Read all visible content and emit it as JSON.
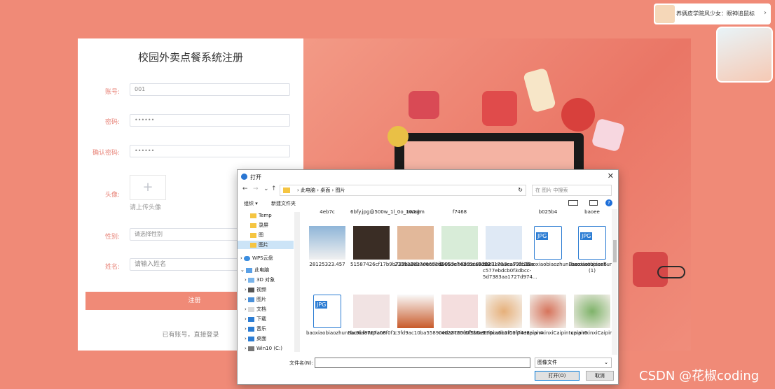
{
  "register": {
    "title": "校园外卖点餐系统注册",
    "account_label": "账号:",
    "account_value": "001",
    "password_label": "密码:",
    "password_value": "••••••",
    "confirm_label": "确认密码:",
    "confirm_value": "••••••",
    "avatar_label": "头像:",
    "avatar_plus": "+",
    "avatar_hint": "请上传头像",
    "gender_label": "性别:",
    "gender_placeholder": "请选择性别",
    "name_label": "姓名:",
    "name_placeholder": "请输入姓名",
    "submit_label": "注册",
    "login_link": "已有账号，直接登录"
  },
  "ad": {
    "text": "养俩皮学院风少女：眼神追鼠标",
    "arrow": "›"
  },
  "dialog": {
    "title": "打开",
    "close": "✕",
    "nav_back": "←",
    "nav_forward": "→",
    "nav_recent": "⌄",
    "nav_up": "↑",
    "breadcrumb": "›  此电脑  ›  桌面  ›  图片",
    "refresh": "↻",
    "search_placeholder": "在 图片 中搜索",
    "toolbar_organize": "组织 ▾",
    "toolbar_new_folder": "新建文件夹",
    "help": "?",
    "tree": [
      {
        "label": "Temp",
        "kind": "folder"
      },
      {
        "label": "录屏",
        "kind": "folder"
      },
      {
        "label": "图",
        "kind": "folder"
      },
      {
        "label": "图片",
        "kind": "folder",
        "selected": true
      },
      {
        "label": "WPS云盘",
        "kind": "cloud"
      },
      {
        "label": "此电脑",
        "kind": "pc"
      },
      {
        "label": "3D 对象",
        "kind": "3d"
      },
      {
        "label": "视频",
        "kind": "video"
      },
      {
        "label": "图片",
        "kind": "pictures"
      },
      {
        "label": "文档",
        "kind": "docs"
      },
      {
        "label": "下载",
        "kind": "download"
      },
      {
        "label": "音乐",
        "kind": "music"
      },
      {
        "label": "桌面",
        "kind": "desktop"
      },
      {
        "label": "Win10 (C:)",
        "kind": "drive"
      }
    ],
    "files_top_row": [
      "4eb7c",
      "6bfy.jpg@500w_1l_0o_100sh",
      "owagm",
      "f7468",
      "b025b4",
      "baoee"
    ],
    "files": [
      {
        "name": "28125323.457",
        "thumb": "car"
      },
      {
        "name": "51587426cf17b9b739ba0dea0ec92f9",
        "thumb": "dark"
      },
      {
        "name": "233933837e66ded565de743cbda9d52",
        "thumb": "face"
      },
      {
        "name": "a0063ebdd93c662027170aea932b12e",
        "thumb": "box"
      },
      {
        "name": "abe1eea3ca79fc28-c577ebdcb0f3dbcc-5d7383aa1727d974...",
        "thumb": "med"
      },
      {
        "name": "baoxiaobiaozhunBaoxiaotupian6",
        "thumb": "jpg"
      },
      {
        "name": "baoxiaobiaozhunBaoxiaotupian8 (1)",
        "thumb": "jpg"
      },
      {
        "name": "baoxiaobiaozhunBaoxiaotupian8",
        "thumb": "jpg"
      },
      {
        "name": "bc9bf8767a06f0f1",
        "thumb": "ad"
      },
      {
        "name": "c3fd9ac10ba55890eda8c25f6f336a9",
        "thumb": "rooster"
      },
      {
        "name": "c4022760c0f5b0e270ca5b3f50f74e3",
        "thumb": "pack"
      },
      {
        "name": "caipinxinxiCaipintupian4",
        "thumb": "food1"
      },
      {
        "name": "caipinxinxiCaipintupian6",
        "thumb": "food2"
      },
      {
        "name": "caipinxinxiCaipintupian8",
        "thumb": "food3"
      }
    ],
    "filename_label": "文件名(N):",
    "filetype_value": "图像文件",
    "open_button": "打开(O)",
    "cancel_button": "取消"
  },
  "watermark": "CSDN @花椒coding",
  "colors": {
    "accent": "#f08a77",
    "label": "#e8857a",
    "dialog_selection": "#cce4f7",
    "jpg_blue": "#2b7cd3"
  }
}
